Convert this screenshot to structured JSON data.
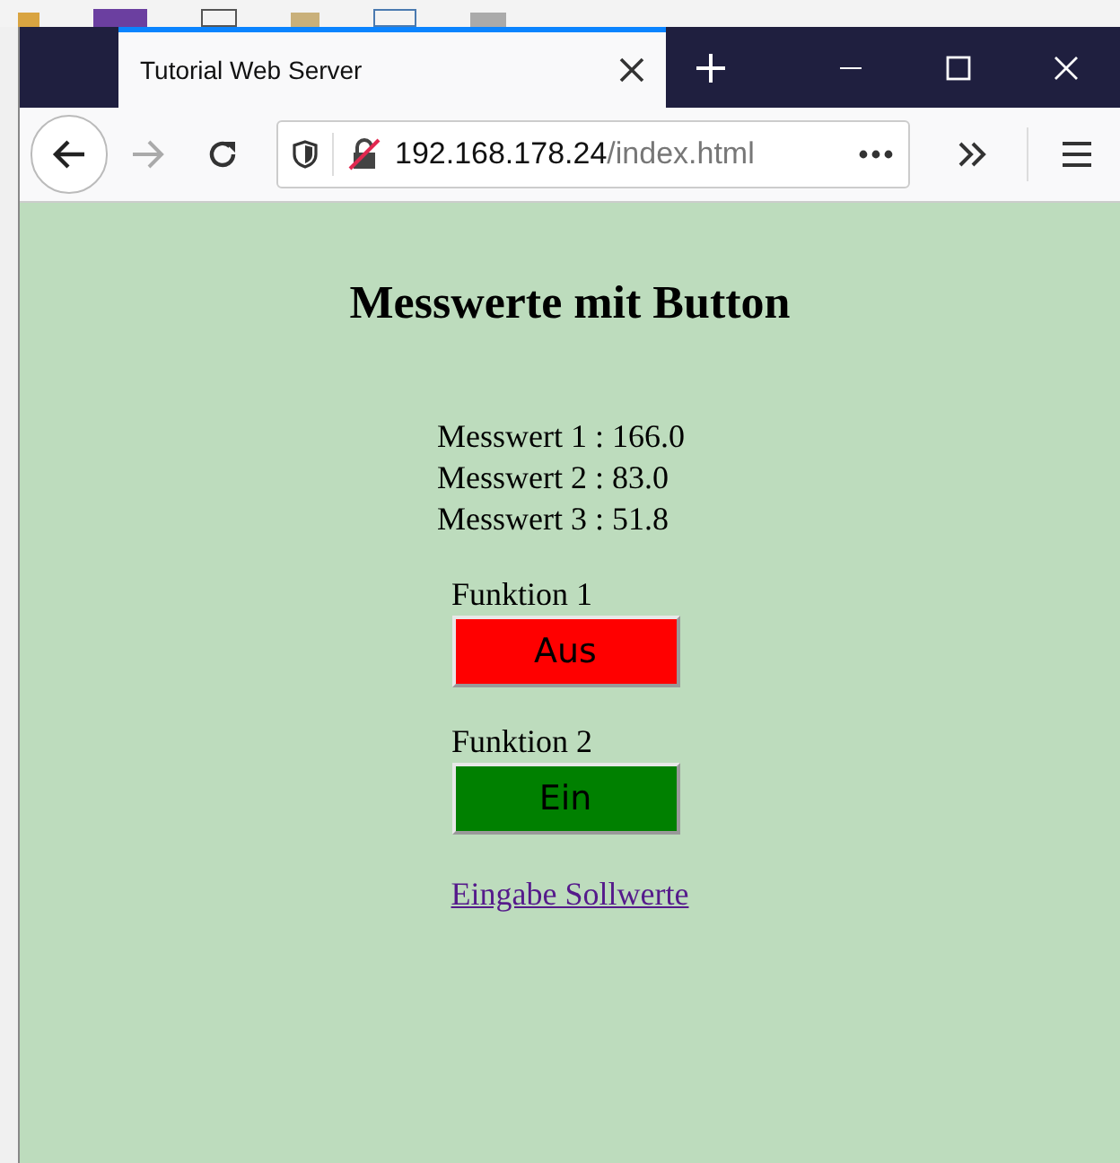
{
  "tab": {
    "title": "Tutorial Web Server",
    "selected": true
  },
  "address_bar": {
    "host": "192.168.178.24",
    "path": "/index.html"
  },
  "page": {
    "heading": "Messwerte mit Button",
    "measurements": [
      "Messwert 1 : 166.0",
      "Messwert 2 : 83.0",
      "Messwert 3 : 51.8"
    ],
    "functions": [
      {
        "label": "Funktion 1",
        "button": "Aus",
        "on": false
      },
      {
        "label": "Funktion 2",
        "button": "Ein",
        "on": true
      }
    ],
    "link": "Eingabe Sollwerte"
  }
}
